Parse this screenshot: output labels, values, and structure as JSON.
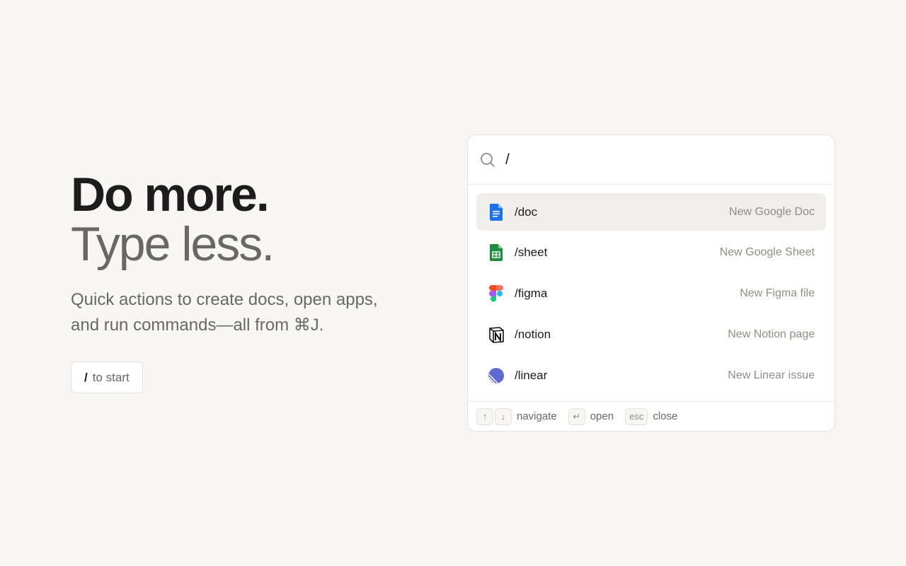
{
  "hero": {
    "title_line1": "Do more.",
    "title_line2": "Type less.",
    "subtitle": "Quick actions to create docs, open apps, and run commands—all from ⌘J.",
    "start_key": "/",
    "start_label": "to start"
  },
  "palette": {
    "search": {
      "value": "/",
      "icon": "search-icon"
    },
    "results": [
      {
        "command": "/doc",
        "description": "New Google Doc",
        "icon": "google-docs-icon",
        "active": true
      },
      {
        "command": "/sheet",
        "description": "New Google Sheet",
        "icon": "google-sheets-icon",
        "active": false
      },
      {
        "command": "/figma",
        "description": "New Figma file",
        "icon": "figma-icon",
        "active": false
      },
      {
        "command": "/notion",
        "description": "New Notion page",
        "icon": "notion-icon",
        "active": false
      },
      {
        "command": "/linear",
        "description": "New Linear issue",
        "icon": "linear-icon",
        "active": false
      }
    ],
    "footer": {
      "navigate_keys": [
        "↑",
        "↓"
      ],
      "navigate_label": "navigate",
      "open_key": "↵",
      "open_label": "open",
      "close_key": "esc",
      "close_label": "close"
    }
  },
  "colors": {
    "background": "#f7f6f3",
    "active_row": "#efeeeb",
    "google_docs": "#1a73e8",
    "google_sheets": "#1e8e3e",
    "linear": "#5e6ad2"
  }
}
